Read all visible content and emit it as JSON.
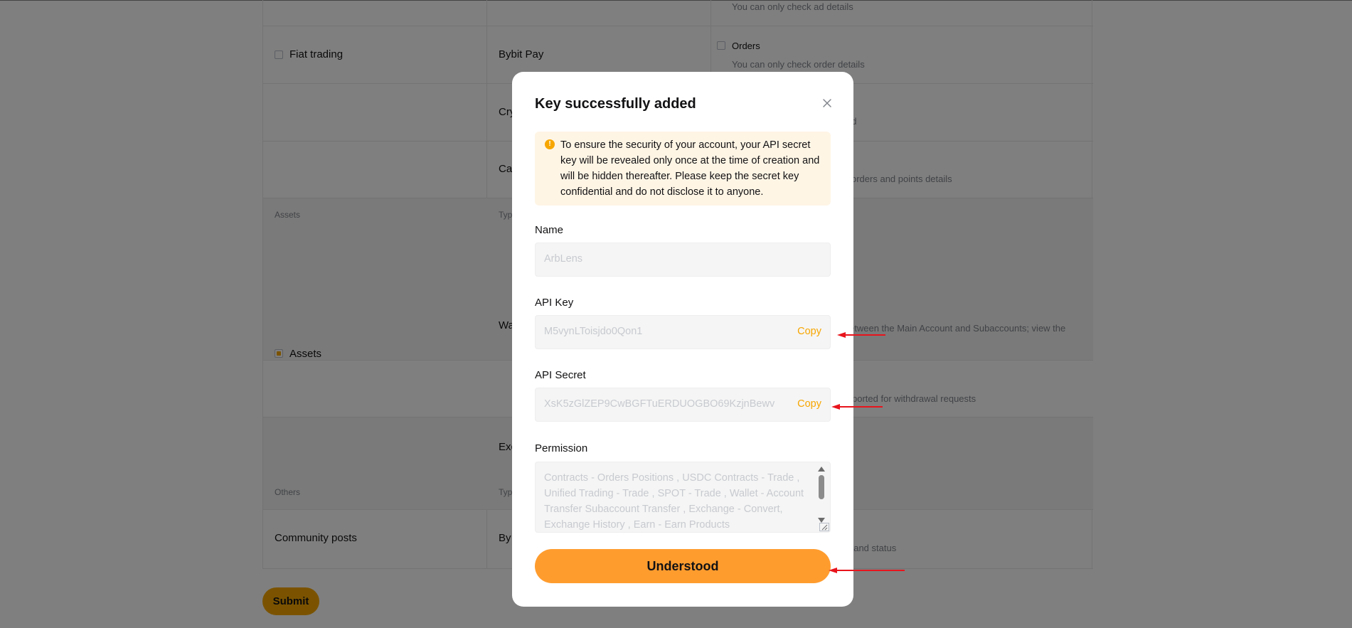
{
  "background": {
    "rows": {
      "ad_details_note": "You can only check ad details",
      "fiat_trading": "Fiat trading",
      "bybit_pay": "Bybit Pay",
      "orders_label": "Orders",
      "orders_note": "You can only check order details",
      "cry_partial": "Cry",
      "cry_note_partial": "ed",
      "ca_partial": "Ca",
      "ca_note_partial": "orders and points details",
      "assets_header": "Assets",
      "type_header_1": "Typ",
      "assets_label": "Assets",
      "wa_partial": "Wa",
      "wa_note_partial": "etween the Main Account and Subaccounts; view the",
      "withdraw_note_partial": "ported for withdrawal requests",
      "exc_partial": "Exc",
      "others_header": "Others",
      "type_header_2": "Typ",
      "community_posts": "Community posts",
      "by_partial": "By",
      "post_note_partial": "t and status"
    },
    "submit_label": "Submit"
  },
  "modal": {
    "title": "Key successfully added",
    "notice": "To ensure the security of your account, your API secret key will be revealed only once at the time of creation and will be hidden thereafter. Please keep the secret key confidential and do not disclose it to anyone.",
    "name_label": "Name",
    "name_value": "ArbLens",
    "api_key_label": "API Key",
    "api_key_value": "M5vynLToisjdo0Qon1",
    "api_secret_label": "API Secret",
    "api_secret_value": "XsK5zGlZEP9CwBGFTuERDUOGBO69KzjnBewv",
    "copy_label": "Copy",
    "permission_label": "Permission",
    "permission_value": "Contracts - Orders Positions , USDC Contracts - Trade , Unified Trading - Trade , SPOT - Trade , Wallet - Account Transfer Subaccount Transfer , Exchange - Convert, Exchange History , Earn - Earn Products",
    "understood_label": "Understood"
  },
  "colors": {
    "accent": "#f7a600",
    "button": "#ff9c2e",
    "notice_bg": "#fff5e5",
    "annotation_arrow": "#e8141c"
  }
}
